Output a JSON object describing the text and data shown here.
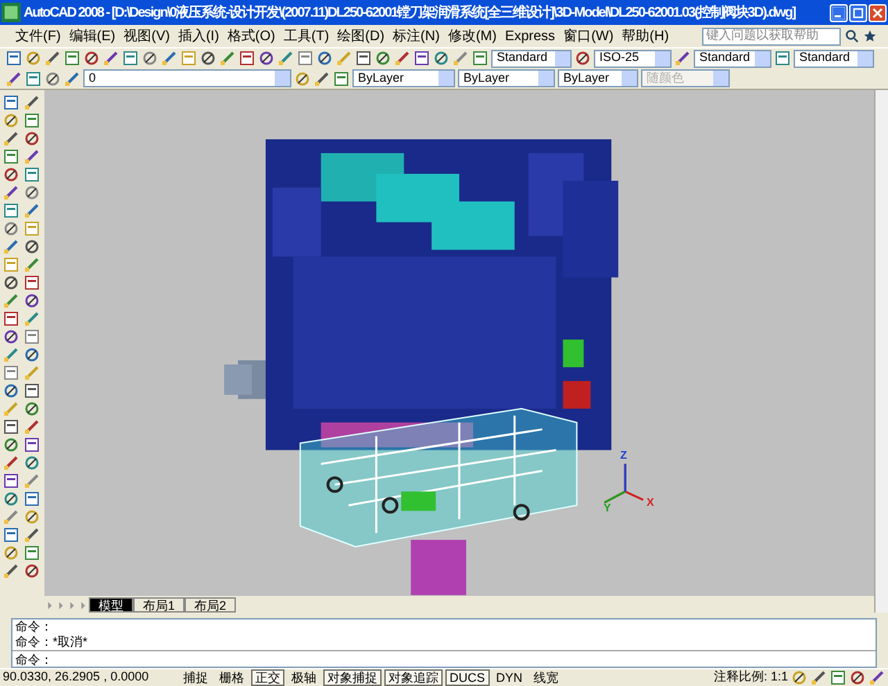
{
  "window": {
    "title": "AutoCAD 2008 - [D:\\Design\\0液压系统-设计开发\\(2007.11)DL250-62001镗刀架润滑系统[全三维设计]\\3D-Model\\DL250-62001.03(控制阀块3D).dwg]"
  },
  "menu": [
    "文件(F)",
    "编辑(E)",
    "视图(V)",
    "插入(I)",
    "格式(O)",
    "工具(T)",
    "绘图(D)",
    "标注(N)",
    "修改(M)",
    "Express",
    "窗口(W)",
    "帮助(H)"
  ],
  "help_search": {
    "placeholder": "键入问题以获取帮助"
  },
  "styles": [
    {
      "kind": "text",
      "value": "Standard"
    },
    {
      "kind": "dim",
      "value": "ISO-25"
    },
    {
      "kind": "table",
      "value": "Standard"
    },
    {
      "kind": "mleader",
      "value": "Standard"
    }
  ],
  "layer": {
    "value": "0"
  },
  "properties": [
    {
      "kind": "color",
      "value": "ByLayer",
      "disabled": false
    },
    {
      "kind": "linetype",
      "value": "ByLayer",
      "disabled": false
    },
    {
      "kind": "lineweight",
      "value": "ByLayer",
      "disabled": false
    },
    {
      "kind": "plotstyle",
      "value": "随颜色",
      "disabled": true
    }
  ],
  "ucs_labels": [
    "Z",
    "Y",
    "X"
  ],
  "layout_tabs": [
    {
      "label": "模型",
      "selected": true
    },
    {
      "label": "布局1",
      "selected": false
    },
    {
      "label": "布局2",
      "selected": false
    }
  ],
  "command_history": [
    "命令：",
    "命令：*取消*"
  ],
  "command_prompt": "命令：",
  "status_bar": {
    "coordinates": "90.0330,  26.2905 , 0.0000",
    "toggles": [
      {
        "label": "捕捉",
        "on": false
      },
      {
        "label": "栅格",
        "on": false
      },
      {
        "label": "正交",
        "on": true
      },
      {
        "label": "极轴",
        "on": false
      },
      {
        "label": "对象捕捉",
        "on": true
      },
      {
        "label": "对象追踪",
        "on": true
      },
      {
        "label": "DUCS",
        "on": true
      },
      {
        "label": "DYN",
        "on": false
      },
      {
        "label": "线宽",
        "on": false
      }
    ],
    "annotation_scale": "注释比例: 1:1"
  }
}
